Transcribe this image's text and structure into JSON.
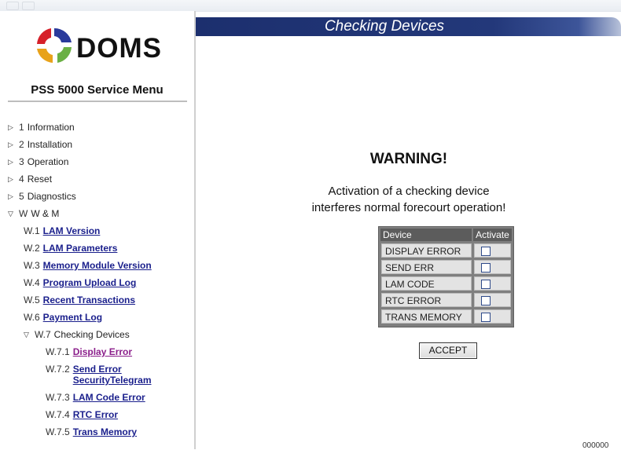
{
  "app": {
    "logo_text": "DOMS",
    "menu_title": "PSS 5000 Service Menu"
  },
  "nav": {
    "items": [
      {
        "num": "1",
        "label": "Information"
      },
      {
        "num": "2",
        "label": "Installation"
      },
      {
        "num": "3",
        "label": "Operation"
      },
      {
        "num": "4",
        "label": "Reset"
      },
      {
        "num": "5",
        "label": "Diagnostics"
      },
      {
        "num": "W",
        "label": "W & M"
      }
    ],
    "wm_items": [
      {
        "num": "W.1",
        "label": "LAM Version"
      },
      {
        "num": "W.2",
        "label": "LAM Parameters"
      },
      {
        "num": "W.3",
        "label": "Memory Module Version"
      },
      {
        "num": "W.4",
        "label": "Program Upload Log"
      },
      {
        "num": "W.5",
        "label": "Recent Transactions"
      },
      {
        "num": "W.6",
        "label": "Payment Log"
      },
      {
        "num": "W.7",
        "label": "Checking Devices"
      }
    ],
    "checking_items": [
      {
        "num": "W.7.1",
        "label": "Display Error"
      },
      {
        "num": "W.7.2",
        "label": "Send Error",
        "label2": "SecurityTelegram"
      },
      {
        "num": "W.7.3",
        "label": "LAM Code Error"
      },
      {
        "num": "W.7.4",
        "label": "RTC Error"
      },
      {
        "num": "W.7.5",
        "label": "Trans Memory"
      }
    ]
  },
  "header": {
    "title": "Checking Devices"
  },
  "warning": {
    "title": "WARNING!",
    "line1": "Activation of a checking device",
    "line2": "interferes normal forecourt operation!"
  },
  "device_table": {
    "col_device": "Device",
    "col_activate": "Activate",
    "rows": [
      {
        "name": "DISPLAY ERROR",
        "checked": false
      },
      {
        "name": "SEND ERR SECTEL",
        "checked": false
      },
      {
        "name": "LAM CODE ERROR",
        "checked": false
      },
      {
        "name": "RTC ERROR",
        "checked": false
      },
      {
        "name": "TRANS MEMORY",
        "checked": false
      }
    ]
  },
  "buttons": {
    "accept": "ACCEPT"
  },
  "footer": {
    "code": "000000"
  },
  "colors": {
    "header_bar": "#1c2f6e",
    "link": "#1a1f8c",
    "visited_link": "#8b1f8b",
    "table_bg": "#7f7f7f"
  },
  "icons": {
    "expand": "triangle-right-icon",
    "collapse": "triangle-down-icon"
  }
}
